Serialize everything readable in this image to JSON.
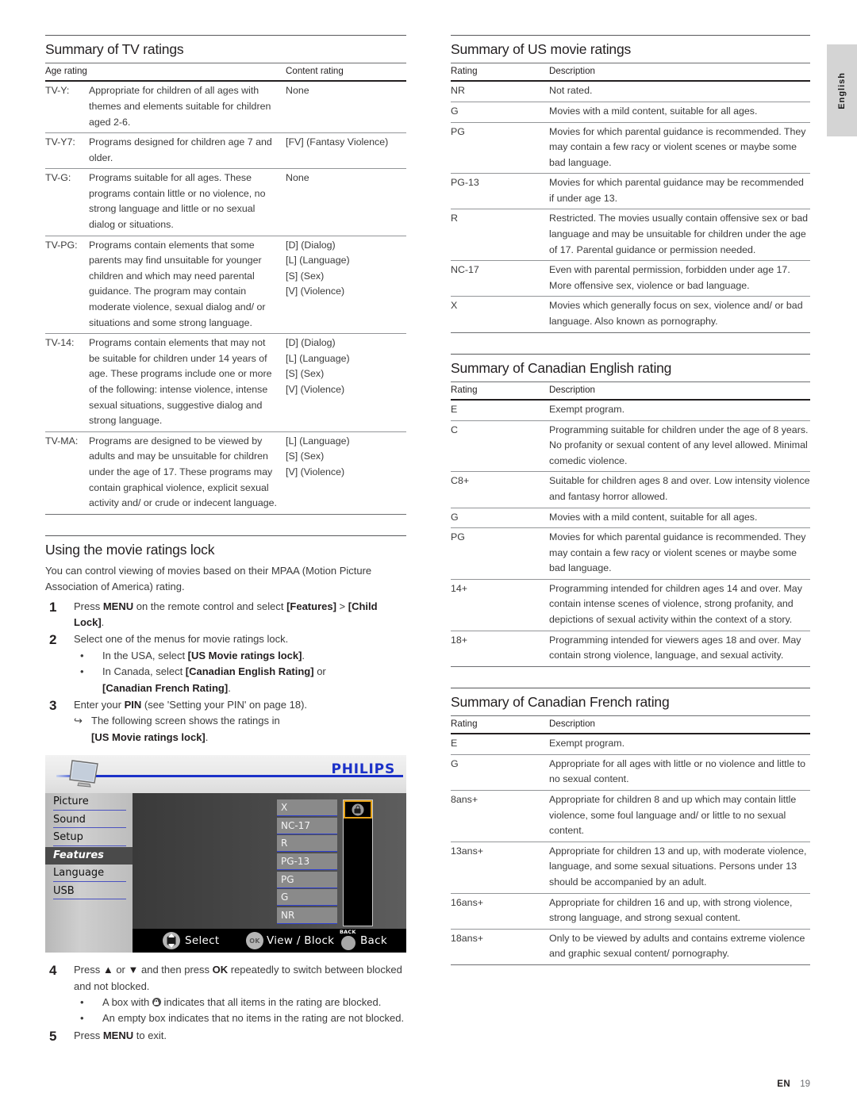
{
  "page": {
    "language_tab": "English",
    "footer_code": "EN",
    "footer_page": "19"
  },
  "tv_ratings": {
    "title": "Summary of TV ratings",
    "headers": [
      "Age rating",
      "Content rating"
    ],
    "rows": [
      {
        "code": "TV-Y:",
        "description": "Appropriate for children of all ages with themes and elements suitable for children aged 2-6.",
        "content": [
          "None"
        ]
      },
      {
        "code": "TV-Y7:",
        "description": "Programs designed for children age 7 and older.",
        "content": [
          "[FV] (Fantasy Violence)"
        ]
      },
      {
        "code": "TV-G:",
        "description": "Programs suitable for all ages. These programs contain little or no violence, no strong language and little or no sexual dialog or situations.",
        "content": [
          "None"
        ]
      },
      {
        "code": "TV-PG:",
        "description": "Programs contain elements that some parents may find unsuitable for younger children and which may need parental guidance. The program may contain moderate violence, sexual dialog and/ or situations and some strong language.",
        "content": [
          "[D] (Dialog)",
          "[L] (Language)",
          "[S] (Sex)",
          "[V] (Violence)"
        ]
      },
      {
        "code": "TV-14:",
        "description": "Programs contain elements that may not be suitable for children under 14 years of age. These programs include one or more of the following: intense violence, intense sexual situations, suggestive dialog and strong language.",
        "content": [
          "[D] (Dialog)",
          "[L] (Language)",
          "[S] (Sex)",
          "[V] (Violence)"
        ]
      },
      {
        "code": "TV-MA:",
        "description": "Programs are designed to be viewed by adults and may be unsuitable for children under the age of 17. These programs may contain graphical violence, explicit sexual activity and/ or crude or indecent language.",
        "content": [
          "[L] (Language)",
          "[S] (Sex)",
          "[V] (Violence)"
        ]
      }
    ]
  },
  "movie_lock": {
    "title": "Using the movie ratings lock",
    "intro": "You can control viewing of movies based on their MPAA (Motion Picture Association of America) rating.",
    "step1": {
      "num": "1",
      "a": "Press ",
      "menu": "MENU",
      "b": " on the remote control and select ",
      "features": "[Features]",
      "c": " > ",
      "childlock": "[Child Lock]",
      "d": "."
    },
    "step2": {
      "num": "2",
      "text": "Select one of the menus for movie ratings lock.",
      "bullets": [
        {
          "pre": "In the USA, select ",
          "strong": "[US Movie ratings lock]",
          "post": "."
        },
        {
          "pre": "In Canada, select ",
          "strong": "[Canadian English Rating]",
          "post": " or"
        },
        {
          "pre": "",
          "strong": "[Canadian French Rating]",
          "post": "."
        }
      ]
    },
    "step3": {
      "num": "3",
      "a": "Enter your ",
      "pin": "PIN",
      "b": " (see 'Setting your PIN' on page 18).",
      "arrow_pre": "The following screen shows the ratings in",
      "arrow_strong": "[US Movie ratings lock]",
      "arrow_post": "."
    },
    "step4": {
      "num": "4",
      "a": "Press ",
      "up": "▲",
      "b": " or ",
      "down": "▼",
      "c": " and then press ",
      "ok": "OK",
      "d": " repeatedly to switch between blocked and not blocked.",
      "bullet1_pre": "A box with ",
      "bullet1_post": " indicates that all items in the rating are blocked.",
      "bullet2": "An empty box indicates that no items in the rating are not blocked."
    },
    "step5": {
      "num": "5",
      "a": "Press ",
      "menu": "MENU",
      "b": " to exit."
    }
  },
  "osd": {
    "brand": "PHILIPS",
    "menu_items": [
      {
        "label": "Picture",
        "active": false
      },
      {
        "label": "Sound",
        "active": false
      },
      {
        "label": "Setup",
        "active": false
      },
      {
        "label": "Features",
        "active": true
      },
      {
        "label": "Language",
        "active": false
      },
      {
        "label": "USB",
        "active": false
      }
    ],
    "ratings": [
      {
        "label": "X",
        "blocked": true,
        "selected": true
      },
      {
        "label": "NC-17",
        "blocked": false,
        "selected": false
      },
      {
        "label": "R",
        "blocked": false,
        "selected": false
      },
      {
        "label": "PG-13",
        "blocked": false,
        "selected": false
      },
      {
        "label": "PG",
        "blocked": false,
        "selected": false
      },
      {
        "label": "G",
        "blocked": false,
        "selected": false
      },
      {
        "label": "NR",
        "blocked": false,
        "selected": false
      }
    ],
    "bar": {
      "select": "Select",
      "ok": "OK",
      "view_block": "View / Block",
      "back_small": "BACK",
      "back": "Back"
    },
    "accent_blue": "#1b31c8",
    "selection_orange": "#e8a317"
  },
  "us_movie": {
    "title": "Summary of US movie ratings",
    "headers": [
      "Rating",
      "Description"
    ],
    "rows": [
      {
        "rating": "NR",
        "description": "Not rated."
      },
      {
        "rating": "G",
        "description": "Movies with a mild content, suitable for all ages."
      },
      {
        "rating": "PG",
        "description": "Movies for which parental guidance is recommended. They may contain a few racy or violent scenes or maybe some bad language."
      },
      {
        "rating": "PG-13",
        "description": "Movies for which parental guidance may be recommended if under age 13."
      },
      {
        "rating": "R",
        "description": "Restricted. The movies usually contain offensive sex or bad language and may be unsuitable for children under the age of 17. Parental guidance or permission needed."
      },
      {
        "rating": "NC-17",
        "description": "Even with parental permission, forbidden under age 17. More offensive sex, violence or bad language."
      },
      {
        "rating": "X",
        "description": "Movies which generally focus on sex, violence and/ or bad language. Also known as pornography."
      }
    ]
  },
  "canadian_english": {
    "title": "Summary of Canadian English rating",
    "headers": [
      "Rating",
      "Description"
    ],
    "rows": [
      {
        "rating": "E",
        "description": "Exempt program."
      },
      {
        "rating": "C",
        "description": "Programming suitable for children under the age of 8 years. No profanity or sexual content of any level allowed. Minimal comedic violence."
      },
      {
        "rating": "C8+",
        "description": "Suitable for children ages 8 and over. Low intensity violence and fantasy horror allowed."
      },
      {
        "rating": "G",
        "description": "Movies with a mild content, suitable for all ages."
      },
      {
        "rating": "PG",
        "description": "Movies for which parental guidance is recommended. They may contain a few racy or violent scenes or maybe some bad language."
      },
      {
        "rating": "14+",
        "description": "Programming intended for children ages 14 and over. May contain intense scenes of violence, strong profanity, and depictions of sexual activity within the context of a story."
      },
      {
        "rating": "18+",
        "description": "Programming intended for viewers ages 18 and over. May contain strong violence, language, and sexual activity."
      }
    ]
  },
  "canadian_french": {
    "title": "Summary of Canadian French rating",
    "headers": [
      "Rating",
      "Description"
    ],
    "rows": [
      {
        "rating": "E",
        "description": "Exempt program."
      },
      {
        "rating": "G",
        "description": "Appropriate for all ages with little or no violence and little to no sexual content."
      },
      {
        "rating": "8ans+",
        "description": "Appropriate for children 8 and up which may contain little violence, some foul language and/ or little to no sexual content."
      },
      {
        "rating": "13ans+",
        "description": "Appropriate for children 13 and up, with moderate violence, language, and some sexual situations. Persons under 13 should be accompanied by an adult."
      },
      {
        "rating": "16ans+",
        "description": "Appropriate for children 16 and up, with strong violence, strong language, and strong sexual content."
      },
      {
        "rating": "18ans+",
        "description": "Only to be viewed by adults and contains extreme violence and graphic sexual content/ pornography."
      }
    ]
  }
}
